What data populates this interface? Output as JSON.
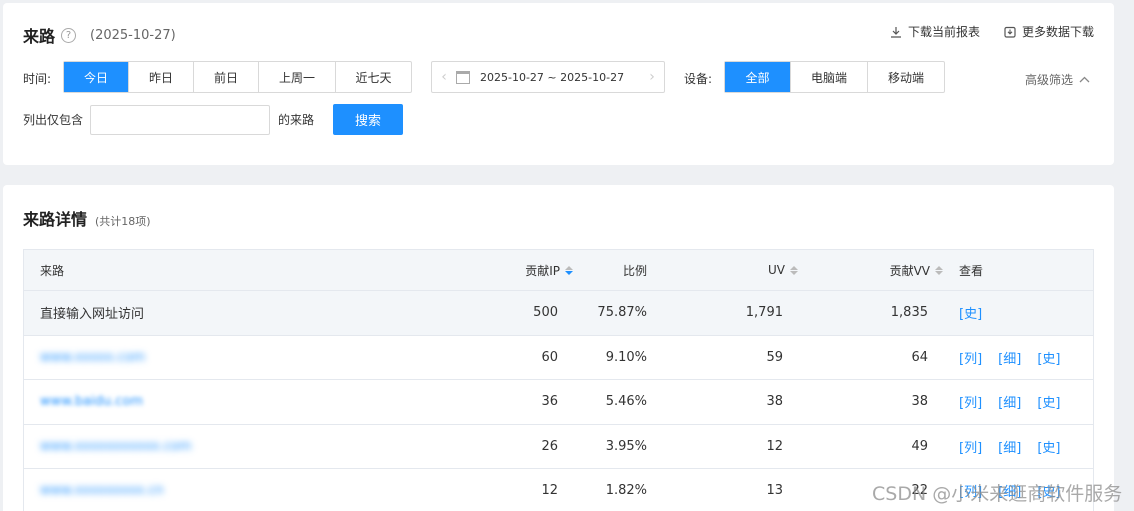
{
  "header": {
    "title": "来路",
    "help_icon": "?",
    "date": "(2025-10-27)",
    "download_current": "下载当前报表",
    "download_more": "更多数据下载"
  },
  "filters": {
    "time_label": "时间:",
    "time_options": [
      "今日",
      "昨日",
      "前日",
      "上周一",
      "近七天"
    ],
    "date_range": "2025-10-27 ~ 2025-10-27",
    "device_label": "设备:",
    "device_options": [
      "全部",
      "电脑端",
      "移动端"
    ],
    "advanced": "高级筛选",
    "include_label": "列出仅包含",
    "include_input": {
      "value": "",
      "placeholder": ""
    },
    "source_suffix": "的来路",
    "search_button": "搜索"
  },
  "detail": {
    "title": "来路详情",
    "count": "(共计18项)",
    "columns": [
      "来路",
      "贡献IP",
      "比例",
      "UV",
      "贡献VV",
      "查看"
    ],
    "rows": [
      {
        "source": "直接输入网址访问",
        "ip": "500",
        "ratio": "75.87%",
        "uv": "1,791",
        "vv": "1,835",
        "links": [
          "[史]"
        ]
      },
      {
        "source": "www.xxxxx.com",
        "ip": "60",
        "ratio": "9.10%",
        "uv": "59",
        "vv": "64",
        "links": [
          "[列]",
          "[细]",
          "[史]"
        ]
      },
      {
        "source": "www.baidu.com",
        "ip": "36",
        "ratio": "5.46%",
        "uv": "38",
        "vv": "38",
        "links": [
          "[列]",
          "[细]",
          "[史]"
        ]
      },
      {
        "source": "www.xxxxxxxxxxx.com",
        "ip": "26",
        "ratio": "3.95%",
        "uv": "12",
        "vv": "49",
        "links": [
          "[列]",
          "[细]",
          "[史]"
        ]
      },
      {
        "source": "www.xxxxxxxxx.cn",
        "ip": "12",
        "ratio": "1.82%",
        "uv": "13",
        "vv": "22",
        "links": [
          "[列]",
          "[细]",
          "[史]"
        ]
      }
    ]
  },
  "watermark": "CSDN @小米来逛商软件服务",
  "colors": {
    "accent": "#1e90ff",
    "background": "#eef0f3"
  }
}
